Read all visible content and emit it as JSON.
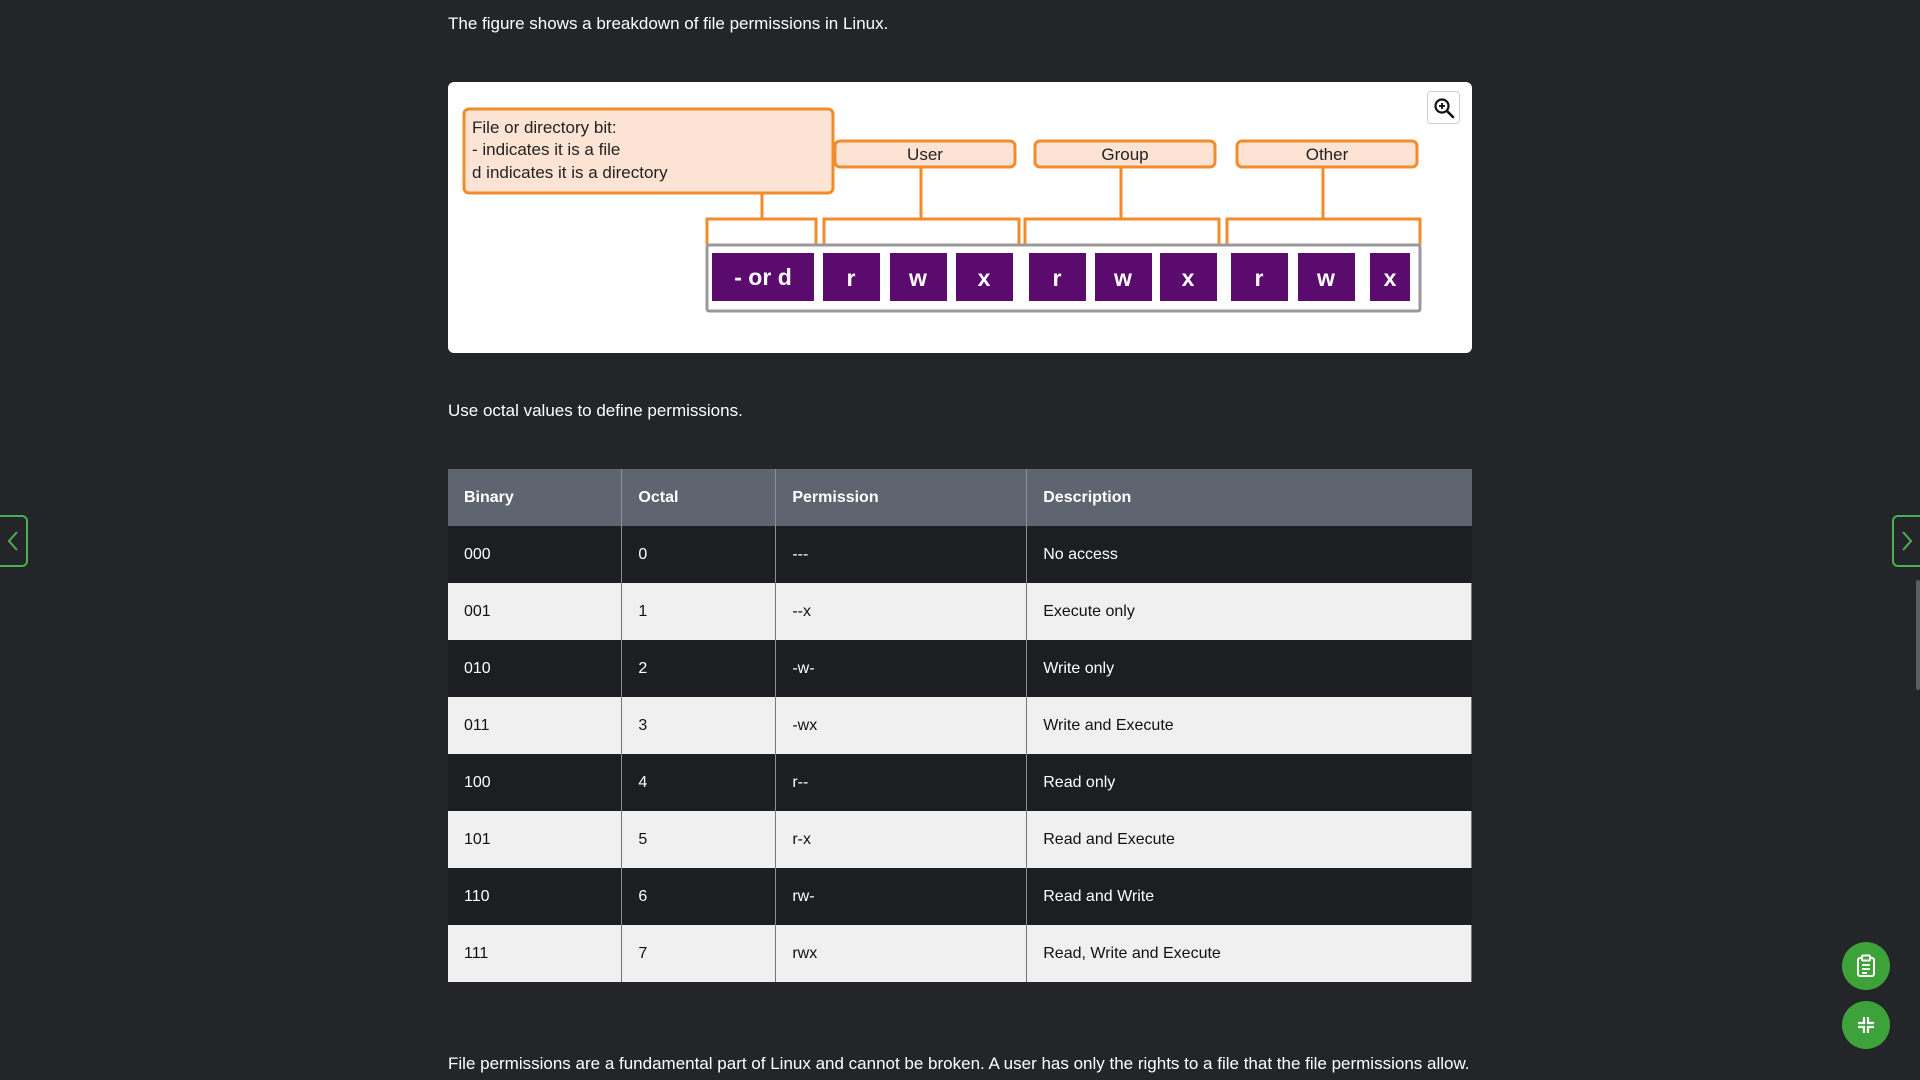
{
  "intro_text": "The figure shows a breakdown of file permissions in Linux.",
  "figure": {
    "callout_lines": [
      "File or directory bit:",
      "- indicates it is a file",
      "d indicates it is a directory"
    ],
    "group_labels": {
      "user": "User",
      "group": "Group",
      "other": "Other"
    },
    "bits": [
      "- or d",
      "r",
      "w",
      "x",
      "r",
      "w",
      "x",
      "r",
      "w",
      "x"
    ],
    "zoom_icon": "zoom-in-icon",
    "colors": {
      "accent": "#f08c2c",
      "callout_fill": "#fde3d3",
      "bit_fill": "#5b0a6e"
    }
  },
  "octal_intro": "Use octal values to define permissions.",
  "table": {
    "headers": {
      "binary": "Binary",
      "octal": "Octal",
      "permission": "Permission",
      "description": "Description"
    },
    "rows": [
      {
        "binary": "000",
        "octal": "0",
        "permission": "---",
        "description": "No access"
      },
      {
        "binary": "001",
        "octal": "1",
        "permission": "--x",
        "description": "Execute only"
      },
      {
        "binary": "010",
        "octal": "2",
        "permission": "-w-",
        "description": "Write only"
      },
      {
        "binary": "011",
        "octal": "3",
        "permission": "-wx",
        "description": "Write and Execute"
      },
      {
        "binary": "100",
        "octal": "4",
        "permission": "r--",
        "description": "Read only"
      },
      {
        "binary": "101",
        "octal": "5",
        "permission": "r-x",
        "description": "Read and Execute"
      },
      {
        "binary": "110",
        "octal": "6",
        "permission": "rw-",
        "description": "Read and Write"
      },
      {
        "binary": "111",
        "octal": "7",
        "permission": "rwx",
        "description": "Read, Write and Execute"
      }
    ]
  },
  "bottom_text": "File permissions are a fundamental part of Linux and cannot be broken. A user has only the rights to a file that the file permissions allow. The",
  "navigation": {
    "prev_icon": "chevron-left-icon",
    "next_icon": "chevron-right-icon"
  },
  "fabs": {
    "notes_icon": "clipboard-icon",
    "collapse_icon": "collapse-icon"
  },
  "colors": {
    "background": "#232529",
    "fab_green": "#3ea23b",
    "table_header": "#5e6570"
  }
}
